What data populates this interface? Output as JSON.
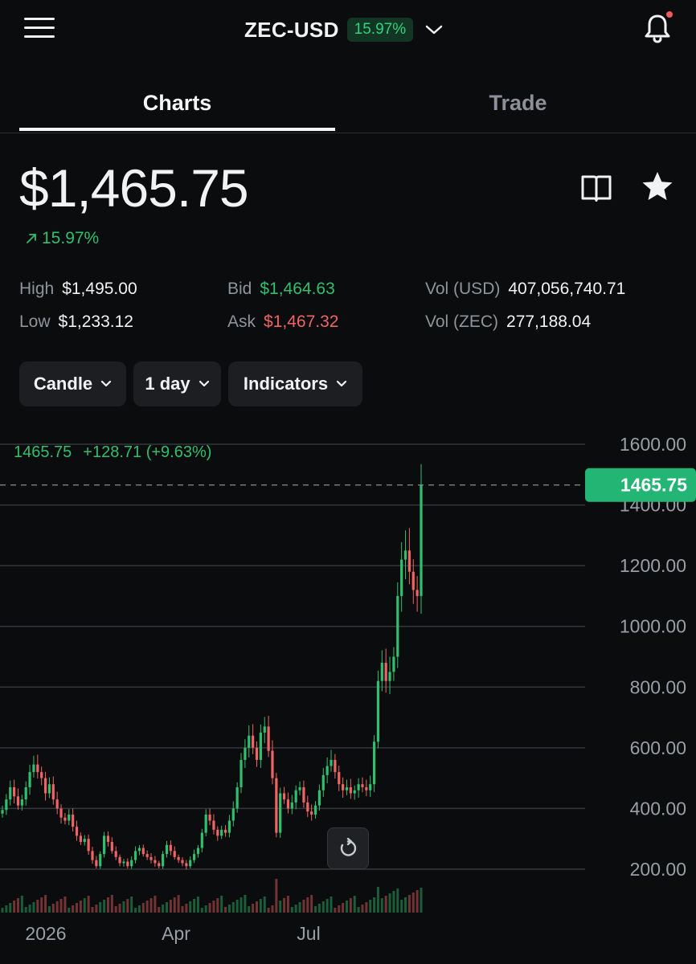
{
  "header": {
    "pair": "ZEC-USD",
    "change_badge": "15.97%"
  },
  "tabs": [
    {
      "label": "Charts",
      "active": true
    },
    {
      "label": "Trade",
      "active": false
    }
  ],
  "price": {
    "value": "$1,465.75",
    "change": "15.97%"
  },
  "stats": {
    "high_label": "High",
    "high": "$1,495.00",
    "low_label": "Low",
    "low": "$1,233.12",
    "bid_label": "Bid",
    "bid": "$1,464.63",
    "ask_label": "Ask",
    "ask": "$1,467.32",
    "vol_usd_label": "Vol (USD)",
    "vol_usd": "407,056,740.71",
    "vol_zec_label": "Vol (ZEC)",
    "vol_zec": "277,188.04"
  },
  "controls": {
    "chart_type": "Candle",
    "interval": "1 day",
    "indicators": "Indicators"
  },
  "colors": {
    "up": "#2fbf6e",
    "down": "#ef6464",
    "background": "#0b0c0e",
    "price_tag": "#22b573"
  },
  "chart_data": {
    "type": "candlestick",
    "ohlc_readout": {
      "last": "1465.75",
      "change": "+128.71 (+9.63%)"
    },
    "current_price_label": "1465.75",
    "current_price": 1465.75,
    "y_ticks": [
      "1600.00",
      "1400.00",
      "1200.00",
      "1000.00",
      "800.00",
      "600.00",
      "400.00",
      "200.00"
    ],
    "x_ticks": [
      "2026",
      "Apr",
      "Jul"
    ],
    "ylim": [
      120,
      1650
    ],
    "closes": [
      395,
      430,
      470,
      440,
      410,
      430,
      470,
      520,
      545,
      520,
      500,
      450,
      480,
      430,
      400,
      370,
      360,
      380,
      340,
      310,
      290,
      300,
      260,
      230,
      210,
      250,
      310,
      290,
      260,
      240,
      220,
      225,
      210,
      230,
      260,
      270,
      250,
      240,
      230,
      220,
      210,
      250,
      280,
      260,
      240,
      230,
      220,
      210,
      230,
      250,
      270,
      320,
      380,
      360,
      330,
      310,
      330,
      320,
      360,
      400,
      470,
      560,
      600,
      640,
      600,
      560,
      650,
      670,
      590,
      500,
      320,
      450,
      430,
      400,
      420,
      460,
      470,
      420,
      390,
      380,
      410,
      460,
      510,
      540,
      560,
      520,
      480,
      460,
      470,
      450,
      460,
      480,
      470,
      460,
      480,
      620,
      820,
      880,
      820,
      850,
      900,
      1100,
      1220,
      1250,
      1180,
      1120,
      1100,
      1465.75
    ]
  }
}
